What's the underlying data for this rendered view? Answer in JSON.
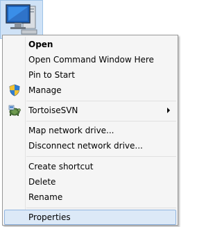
{
  "context_menu": {
    "items": {
      "open": "Open",
      "open_command_window": "Open Command Window Here",
      "pin_to_start": "Pin to Start",
      "manage": "Manage",
      "tortoise_svn": "TortoiseSVN",
      "map_network_drive": "Map network drive...",
      "disconnect_network_drive": "Disconnect network drive...",
      "create_shortcut": "Create shortcut",
      "delete": "Delete",
      "rename": "Rename",
      "properties": "Properties"
    },
    "icons": {
      "manage": "shield-icon",
      "tortoise_svn": "tortoisesvn-icon",
      "tortoise_svn_submenu": "submenu-arrow-icon"
    },
    "highlighted_item": "properties",
    "colors": {
      "menu_background": "#f5f5f5",
      "highlight_background": "#dce9f7",
      "highlight_border": "#8fb4e0"
    }
  },
  "desktop_icon": {
    "icon": "computer-icon"
  }
}
